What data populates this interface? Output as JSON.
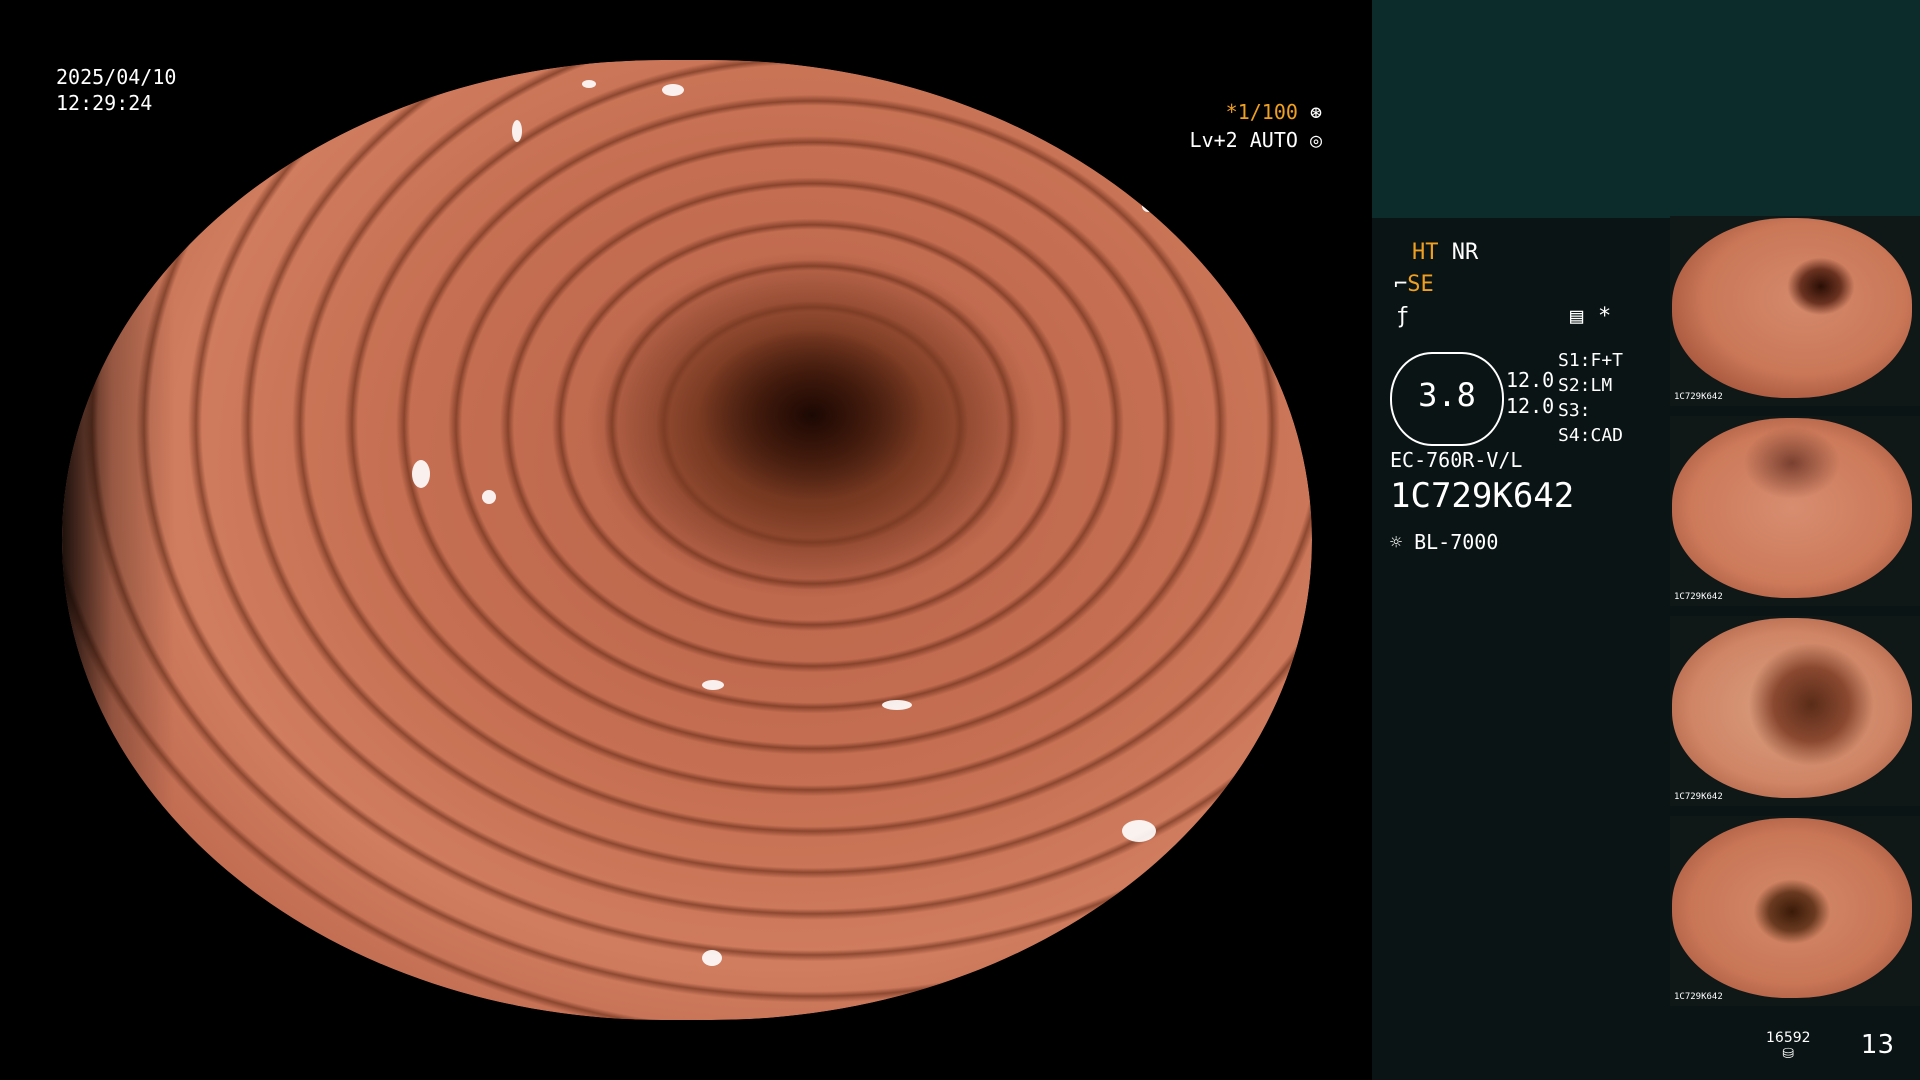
{
  "overlay": {
    "date": "2025/04/10",
    "time": "12:29:24",
    "shutter": "*1/100",
    "level": "Lv+2 AUTO",
    "shutter_icon": "shutter-icon",
    "iris_icon": "iris-icon"
  },
  "panel": {
    "enhance_ht": "HT",
    "enhance_nr": "NR",
    "structure_se": "SE",
    "settings_icon": "settings-icon",
    "star": "*",
    "magnification": "3.8",
    "value_1": "12.0",
    "value_2": "12.0",
    "switch_1": "S1:F+T",
    "switch_2": "S2:LM",
    "switch_3": "S3:",
    "switch_4": "S4:CAD",
    "scope_model": "EC-760R-V/L",
    "scope_serial": "1C729K642",
    "light_source": "BL-7000",
    "light_icon": "light-source-icon"
  },
  "thumbnails": [
    {
      "label": "1C729K642"
    },
    {
      "label": "1C729K642"
    },
    {
      "label": "1C729K642"
    },
    {
      "label": "1C729K642"
    }
  ],
  "footer": {
    "storage_count": "16592",
    "image_count": "13",
    "storage_icon": "storage-icon"
  },
  "colors": {
    "accent": "#f0a020",
    "panel_bg": "#0a1414",
    "panel_top": "#0c2b2b",
    "mucosa": "#c66f52"
  }
}
